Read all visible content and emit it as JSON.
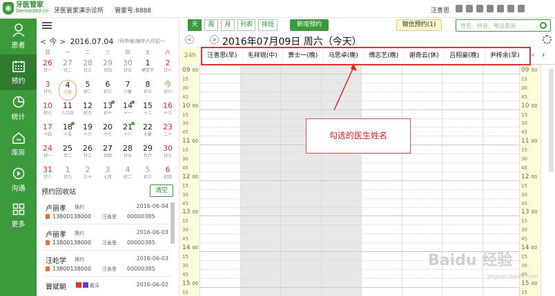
{
  "topbar": {
    "logo_text": "牙医管家",
    "logo_sub": "Dental360.cn",
    "clinic": "牙医管家演示诊所",
    "account": "管家号:8888",
    "user": "汪善思"
  },
  "nav": [
    {
      "label": "患者",
      "icon": "user-icon"
    },
    {
      "label": "预约",
      "icon": "calendar-icon"
    },
    {
      "label": "统计",
      "icon": "pie-chart-icon"
    },
    {
      "label": "库房",
      "icon": "home-icon"
    },
    {
      "label": "沟通",
      "icon": "play-icon"
    },
    {
      "label": "更多",
      "icon": "grid-icon"
    }
  ],
  "calendar": {
    "prev": "<",
    "today": "今",
    "next": ">",
    "date": "2016.07.04",
    "lunar": "(丙申猴)猴年六月初一",
    "weekdays": [
      "日",
      "一",
      "二",
      "三",
      "四",
      "五",
      "六"
    ],
    "weeks": [
      [
        {
          "n": "26",
          "l": "廿一",
          "o": true
        },
        {
          "n": "27",
          "l": "廿二",
          "o": true
        },
        {
          "n": "28",
          "l": "廿三",
          "o": true
        },
        {
          "n": "29",
          "l": "廿四",
          "o": true
        },
        {
          "n": "30",
          "l": "廿五",
          "o": true
        },
        {
          "n": "1",
          "l": "建党节"
        },
        {
          "n": "2",
          "l": "廿八"
        }
      ],
      [
        {
          "n": "3",
          "l": "廿九"
        },
        {
          "n": "4",
          "l": "六月",
          "sel": true
        },
        {
          "n": "5",
          "l": "初二"
        },
        {
          "n": "6",
          "l": "初三"
        },
        {
          "n": "7",
          "l": "小暑"
        },
        {
          "n": "8",
          "l": "初五"
        },
        {
          "n": "今",
          "l": "初六"
        }
      ],
      [
        {
          "n": "10",
          "l": "初七"
        },
        {
          "n": "11",
          "l": "人口日"
        },
        {
          "n": "12",
          "l": "初九"
        },
        {
          "n": "13",
          "l": "初十",
          "dot": true
        },
        {
          "n": "14",
          "l": "十一",
          "dot": true
        },
        {
          "n": "15",
          "l": "十二"
        },
        {
          "n": "16",
          "l": "十三"
        }
      ],
      [
        {
          "n": "17",
          "l": "十四"
        },
        {
          "n": "18",
          "l": "十五",
          "dot": true
        },
        {
          "n": "19",
          "l": "十六"
        },
        {
          "n": "20",
          "l": "十七"
        },
        {
          "n": "21",
          "l": "十八",
          "dot": true
        },
        {
          "n": "22",
          "l": "大暑"
        },
        {
          "n": "23",
          "l": "二十"
        }
      ],
      [
        {
          "n": "24",
          "l": "廿一"
        },
        {
          "n": "25",
          "l": "廿二"
        },
        {
          "n": "26",
          "l": "廿三"
        },
        {
          "n": "27",
          "l": "廿四"
        },
        {
          "n": "28",
          "l": "廿五"
        },
        {
          "n": "29",
          "l": "廿六"
        },
        {
          "n": "30",
          "l": "廿七"
        }
      ],
      [
        {
          "n": "31",
          "l": "廿八"
        },
        {
          "n": "1",
          "l": "廿九",
          "o": true
        },
        {
          "n": "2",
          "l": "三十",
          "o": true
        },
        {
          "n": "3",
          "l": "七月",
          "o": true
        },
        {
          "n": "4",
          "l": "初二",
          "o": true
        },
        {
          "n": "5",
          "l": "初三",
          "o": true
        },
        {
          "n": "6",
          "l": "初四",
          "o": true
        }
      ]
    ]
  },
  "recycle": {
    "title": "预约回收站",
    "clear": "清空",
    "items": [
      {
        "name": "卢丽孝",
        "tag": "换约",
        "date": "2016-06-04",
        "phone": "13800138000",
        "doctor": "汪善思",
        "code": "00000385"
      },
      {
        "name": "卢丽孝",
        "tag": "换约",
        "date": "2016-06-03",
        "phone": "13800138000",
        "doctor": "汪善思",
        "code": "00000385"
      },
      {
        "name": "汪屹学",
        "tag": "换约",
        "date": "2016-06-03",
        "phone": "13800138000",
        "doctor": "汪善思",
        "code": "00000385"
      },
      {
        "name": "曾斌朝",
        "tag": "戴牙",
        "date": "2016-06-02",
        "phone": "",
        "doctor": "",
        "code": ""
      }
    ]
  },
  "toolbar": {
    "views": [
      "天",
      "周",
      "月",
      "列表",
      "排班"
    ],
    "new_appt": "新增预约",
    "wechat": "微信预约(1)",
    "search_placeholder": "姓名、拼音、电话查询"
  },
  "datebar": {
    "prev": "<",
    "next": ">",
    "date": "2016年07月09日 周六（今天）"
  },
  "grid": {
    "h24": "24h",
    "doctors": [
      "汪善思(早)",
      "毛祥锐(中)",
      "萧士一(晚)",
      "马思卓(晚)",
      "傅志艺(晚)",
      "谢奇云(休)",
      "吕翔豪(晚)",
      "尹梓余(早)"
    ],
    "times": [
      {
        "h": "09",
        "m": "00"
      },
      {
        "m": "15"
      },
      {
        "m": "30"
      },
      {
        "m": "45"
      },
      {
        "h": "10",
        "m": "00"
      },
      {
        "m": "15"
      },
      {
        "m": "30"
      },
      {
        "m": "45"
      },
      {
        "h": "11",
        "m": "00"
      },
      {
        "m": "15"
      },
      {
        "m": "30"
      },
      {
        "m": "45"
      },
      {
        "h": "12",
        "m": "00"
      },
      {
        "m": "15"
      },
      {
        "m": "30"
      },
      {
        "m": "45"
      },
      {
        "h": "13",
        "m": "00"
      },
      {
        "m": "15"
      },
      {
        "m": "30"
      },
      {
        "m": "45"
      },
      {
        "h": "14",
        "m": "00"
      },
      {
        "m": "15"
      },
      {
        "m": "30"
      },
      {
        "m": "45"
      },
      {
        "h": "15",
        "m": "00"
      },
      {
        "m": "15"
      }
    ]
  },
  "annotation": "勾选的医生姓名",
  "watermark": "Baidu 经验",
  "watermark_sub": "jingyan.baidu.com"
}
